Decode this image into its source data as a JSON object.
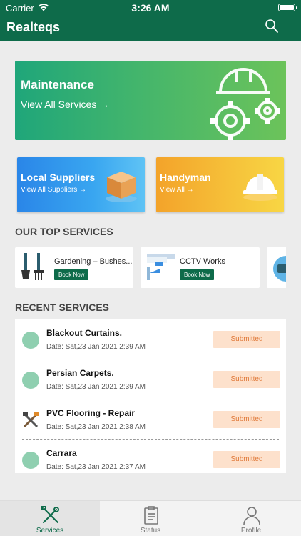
{
  "status_bar": {
    "carrier": "Carrier",
    "time": "3:26 AM"
  },
  "app": {
    "title": "Realteqs"
  },
  "banner": {
    "title": "Maintenance",
    "link": "View All Services →"
  },
  "cards": [
    {
      "title": "Local Suppliers",
      "link": "View All Suppliers →"
    },
    {
      "title": "Handyman",
      "link": "View All →"
    }
  ],
  "top_services": {
    "heading": "OUR TOP SERVICES",
    "items": [
      {
        "name": "Gardening – Bushes...",
        "button": "Book Now"
      },
      {
        "name": "CCTV Works",
        "button": "Book Now"
      }
    ]
  },
  "recent_services": {
    "heading": "RECENT SERVICES",
    "items": [
      {
        "name": "Blackout Curtains.",
        "date": "Date: Sat,23 Jan 2021 2:39 AM",
        "status": "Submitted"
      },
      {
        "name": "Persian Carpets.",
        "date": "Date: Sat,23 Jan 2021 2:39 AM",
        "status": "Submitted"
      },
      {
        "name": "PVC Flooring - Repair",
        "date": "Date: Sat,23 Jan 2021 2:38 AM",
        "status": "Submitted"
      },
      {
        "name": "Carrara",
        "date": "Date: Sat,23 Jan 2021 2:37 AM",
        "status": "Submitted"
      }
    ]
  },
  "tabs": [
    {
      "label": "Services",
      "icon": "tools-icon",
      "active": true
    },
    {
      "label": "Status",
      "icon": "clipboard-icon",
      "active": false
    },
    {
      "label": "Profile",
      "icon": "person-icon",
      "active": false
    }
  ],
  "colors": {
    "brand": "#0e6b4a",
    "status_bg": "#fde1cc",
    "status_text": "#e07a3a"
  }
}
